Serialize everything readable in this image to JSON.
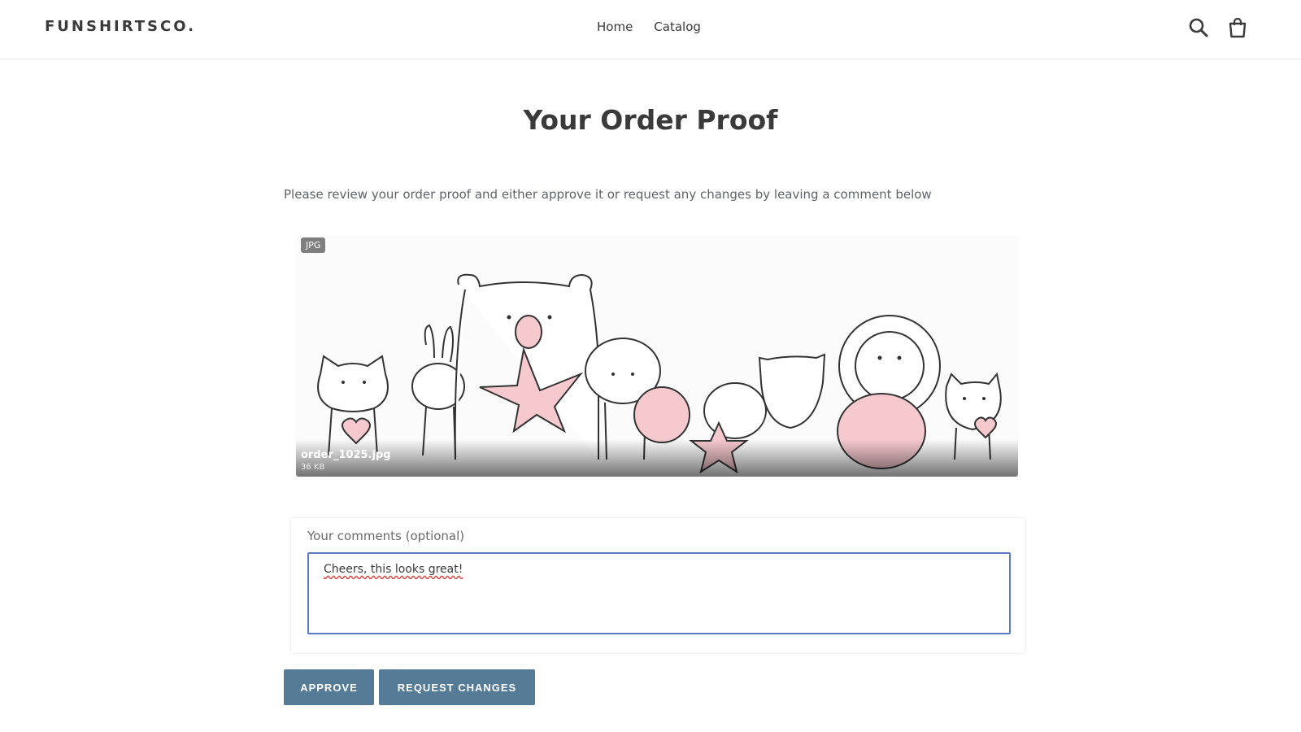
{
  "header": {
    "logo": "FUNSHIRTSCO.",
    "nav": [
      {
        "label": "Home"
      },
      {
        "label": "Catalog"
      }
    ],
    "icons": [
      "search-icon",
      "cart-icon"
    ]
  },
  "page": {
    "title": "Your Order Proof",
    "intro": "Please review your order proof and either approve it or request any changes by leaving a comment below"
  },
  "proof": {
    "badge": "JPG",
    "file_name": "order_1025.jpg",
    "file_size": "36 KB",
    "image": "cute-animals-illustration"
  },
  "comments": {
    "label": "Your comments (optional)",
    "value": "Cheers, this looks great!"
  },
  "actions": {
    "approve_label": "APPROVE",
    "request_changes_label": "REQUEST CHANGES"
  },
  "colors": {
    "button": "#557b97",
    "focus_border": "#5b7bc8",
    "accent_pink": "#f6c9cf"
  }
}
